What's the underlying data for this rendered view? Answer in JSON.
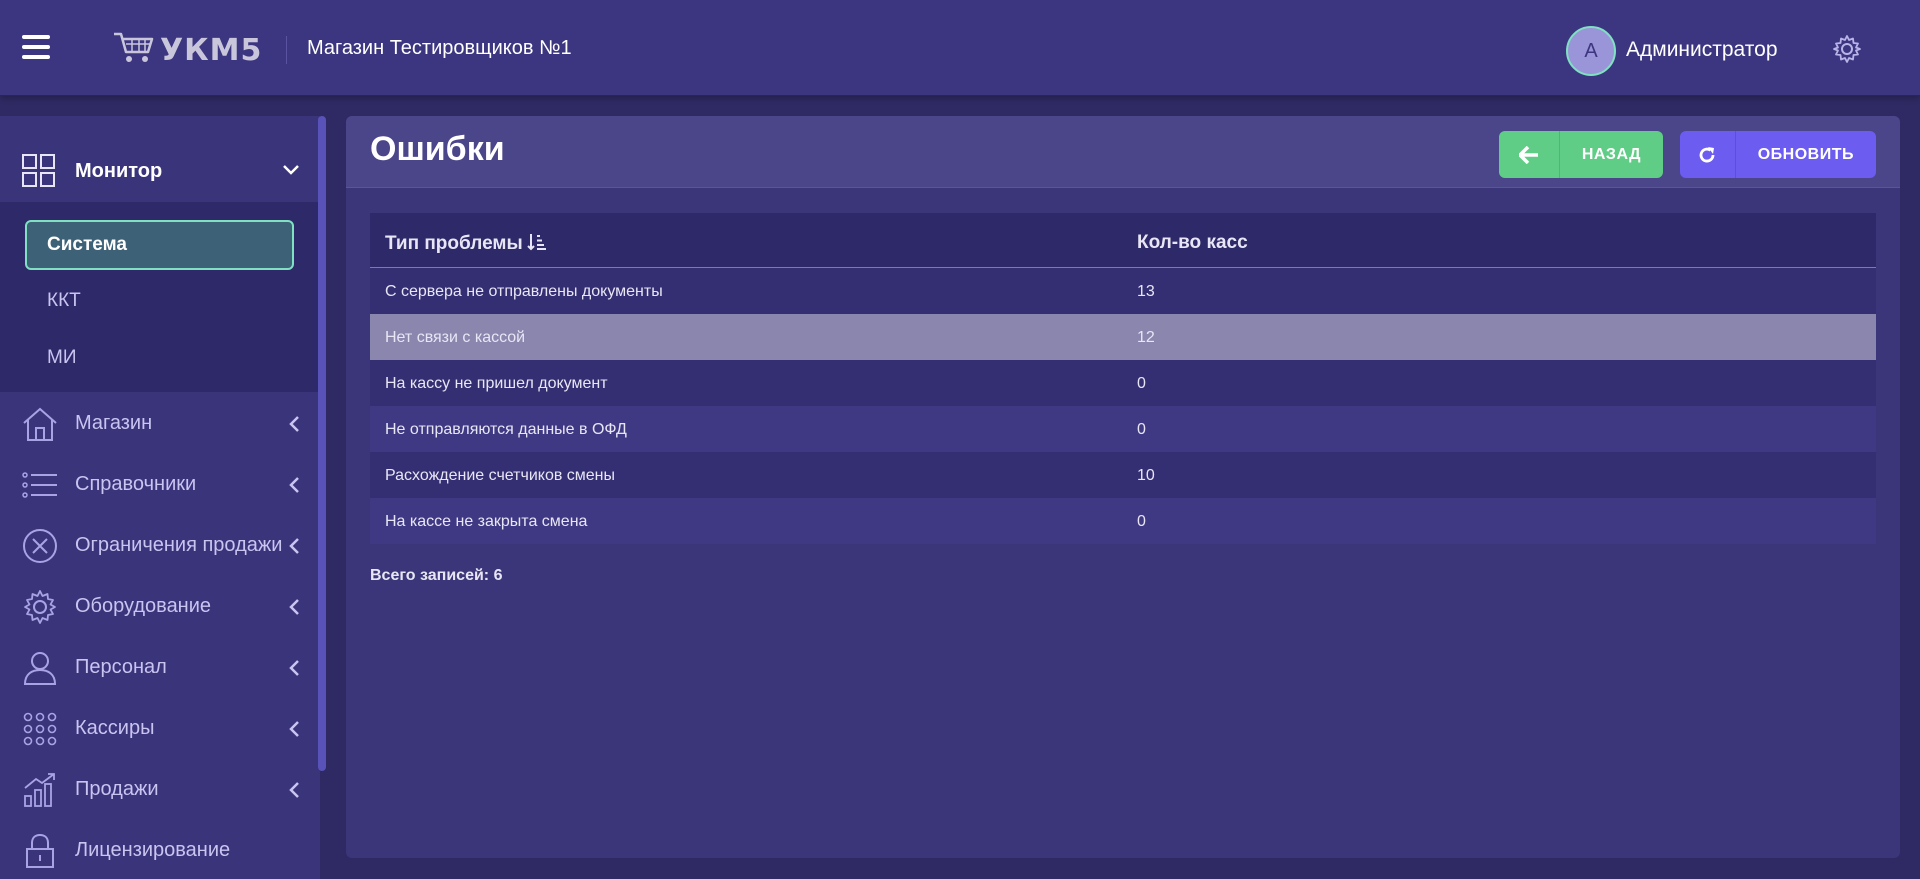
{
  "header": {
    "logo_text": "УКМ5",
    "store_name": "Магазин Тестировщиков №1",
    "avatar_letter": "А",
    "username": "Администратор"
  },
  "sidebar": {
    "monitor": {
      "label": "Монитор",
      "icon": "grid-icon",
      "sub_items": [
        "Система",
        "ККТ",
        "МИ"
      ],
      "active": "Система"
    },
    "items": [
      {
        "label": "Магазин",
        "icon": "home-icon"
      },
      {
        "label": "Справочники",
        "icon": "list-icon"
      },
      {
        "label": "Ограничения продажи",
        "icon": "x-circle-icon"
      },
      {
        "label": "Оборудование",
        "icon": "gear-icon"
      },
      {
        "label": "Персонал",
        "icon": "user-icon"
      },
      {
        "label": "Кассиры",
        "icon": "dots-grid-icon"
      },
      {
        "label": "Продажи",
        "icon": "chart-icon"
      },
      {
        "label": "Лицензирование",
        "icon": "lock-icon"
      }
    ]
  },
  "main": {
    "title": "Ошибки",
    "buttons": {
      "back": "НАЗАД",
      "refresh": "ОБНОВИТЬ"
    },
    "table": {
      "columns": [
        "Тип проблемы",
        "Кол-во касс"
      ],
      "rows": [
        [
          "С сервера не отправлены документы",
          "13"
        ],
        [
          "Нет связи с кассой",
          "12"
        ],
        [
          "На кассу не пришел документ",
          "0"
        ],
        [
          "Не отправляются данные в ОФД",
          "0"
        ],
        [
          "Расхождение счетчиков смены",
          "10"
        ],
        [
          "На кассе не закрыта смена",
          "0"
        ]
      ]
    },
    "total_label": "Всего записей: 6"
  },
  "colors": {
    "header_bg": "#3c3680",
    "sidebar_bg": "#3a347b",
    "accent_green": "#5fcd85",
    "accent_violet": "#6c5cf0",
    "active_border": "#7fe0c2"
  }
}
